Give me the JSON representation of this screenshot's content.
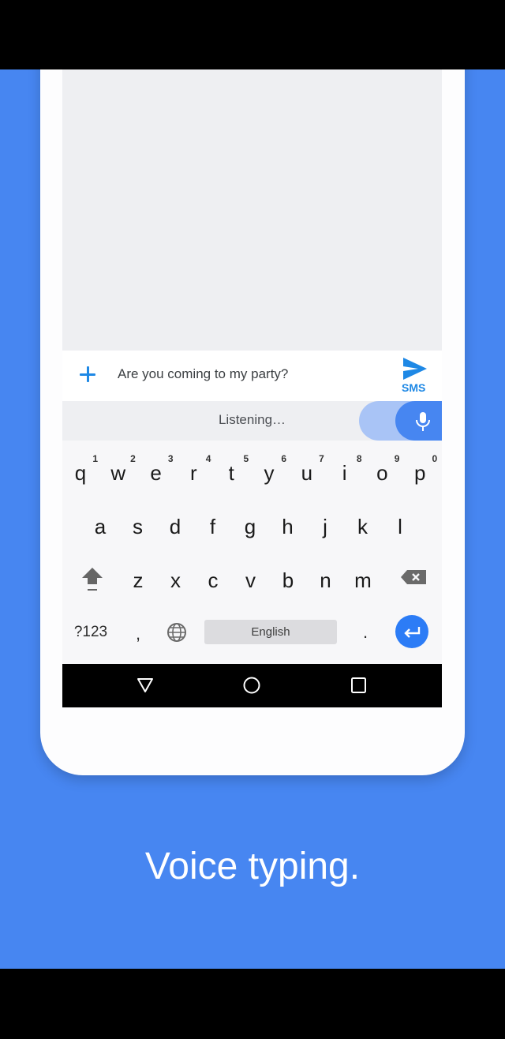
{
  "colors": {
    "background_blue": "#4786f1",
    "accent_blue": "#1e88e5",
    "mic_blue": "#4786f1",
    "mic_halo": "#a9c4f6",
    "enter_blue": "#2c7cf6"
  },
  "compose": {
    "attach_icon": "plus-icon",
    "message_text": "Are you coming to my party?",
    "send_icon": "send-icon",
    "send_label": "SMS"
  },
  "voice": {
    "status_text": "Listening…",
    "mic_icon": "microphone-icon"
  },
  "keyboard": {
    "row1": [
      {
        "key": "q",
        "hint": "1"
      },
      {
        "key": "w",
        "hint": "2"
      },
      {
        "key": "e",
        "hint": "3"
      },
      {
        "key": "r",
        "hint": "4"
      },
      {
        "key": "t",
        "hint": "5"
      },
      {
        "key": "y",
        "hint": "6"
      },
      {
        "key": "u",
        "hint": "7"
      },
      {
        "key": "i",
        "hint": "8"
      },
      {
        "key": "o",
        "hint": "9"
      },
      {
        "key": "p",
        "hint": "0"
      }
    ],
    "row2": [
      "a",
      "s",
      "d",
      "f",
      "g",
      "h",
      "j",
      "k",
      "l"
    ],
    "row3": [
      "z",
      "x",
      "c",
      "v",
      "b",
      "n",
      "m"
    ],
    "shift_icon": "shift-icon",
    "delete_icon": "backspace-icon",
    "symbols_label": "?123",
    "comma_label": ",",
    "globe_icon": "globe-icon",
    "space_label": "English",
    "period_label": ".",
    "enter_icon": "enter-icon"
  },
  "nav": {
    "back_icon": "back-triangle-icon",
    "home_icon": "home-circle-icon",
    "recents_icon": "recents-square-icon"
  },
  "caption": "Voice typing."
}
